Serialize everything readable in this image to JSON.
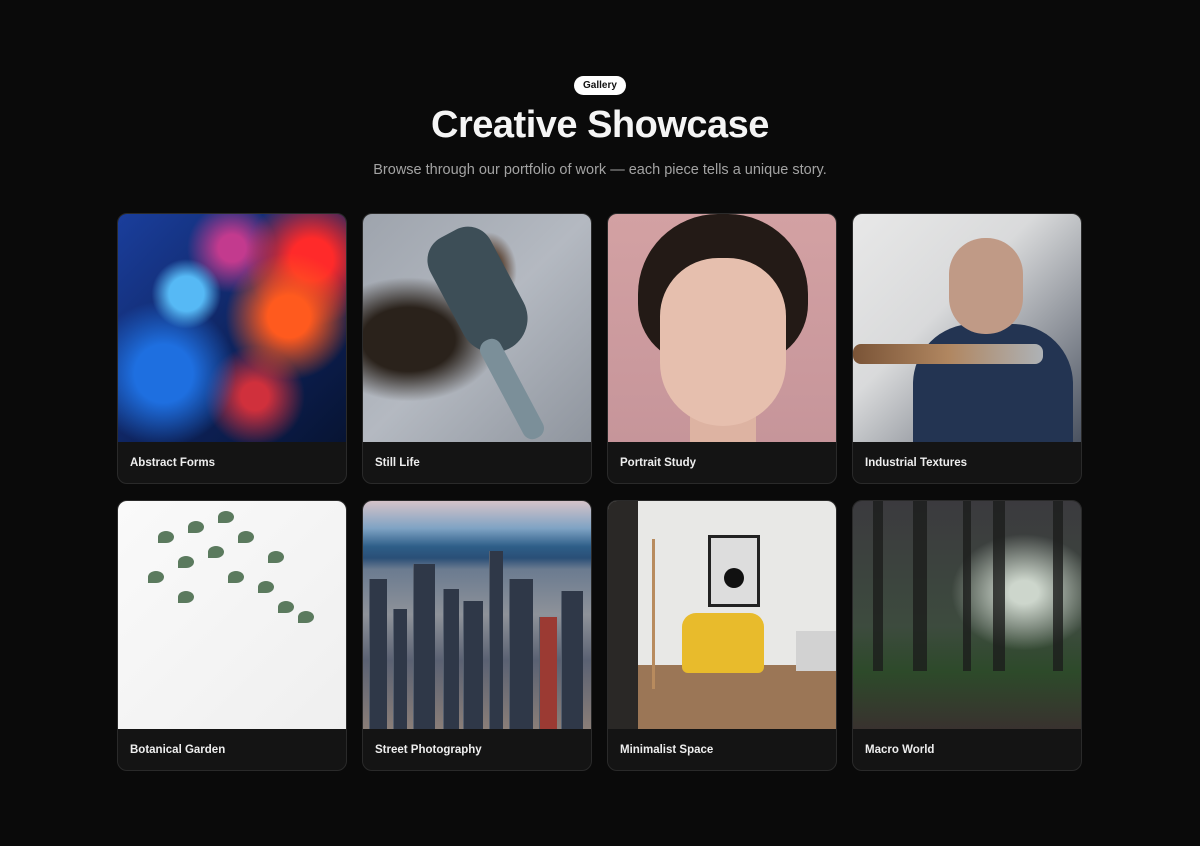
{
  "header": {
    "badge": "Gallery",
    "title": "Creative Showcase",
    "subtitle": "Browse through our portfolio of work — each piece tells a unique story."
  },
  "gallery": {
    "items": [
      {
        "title": "Abstract Forms"
      },
      {
        "title": "Still Life"
      },
      {
        "title": "Portrait Study"
      },
      {
        "title": "Industrial Textures"
      },
      {
        "title": "Botanical Garden"
      },
      {
        "title": "Street Photography"
      },
      {
        "title": "Minimalist Space"
      },
      {
        "title": "Macro World"
      }
    ]
  },
  "colors": {
    "background": "#0a0a0a",
    "card": "#141414",
    "badge": "#ffffff"
  }
}
